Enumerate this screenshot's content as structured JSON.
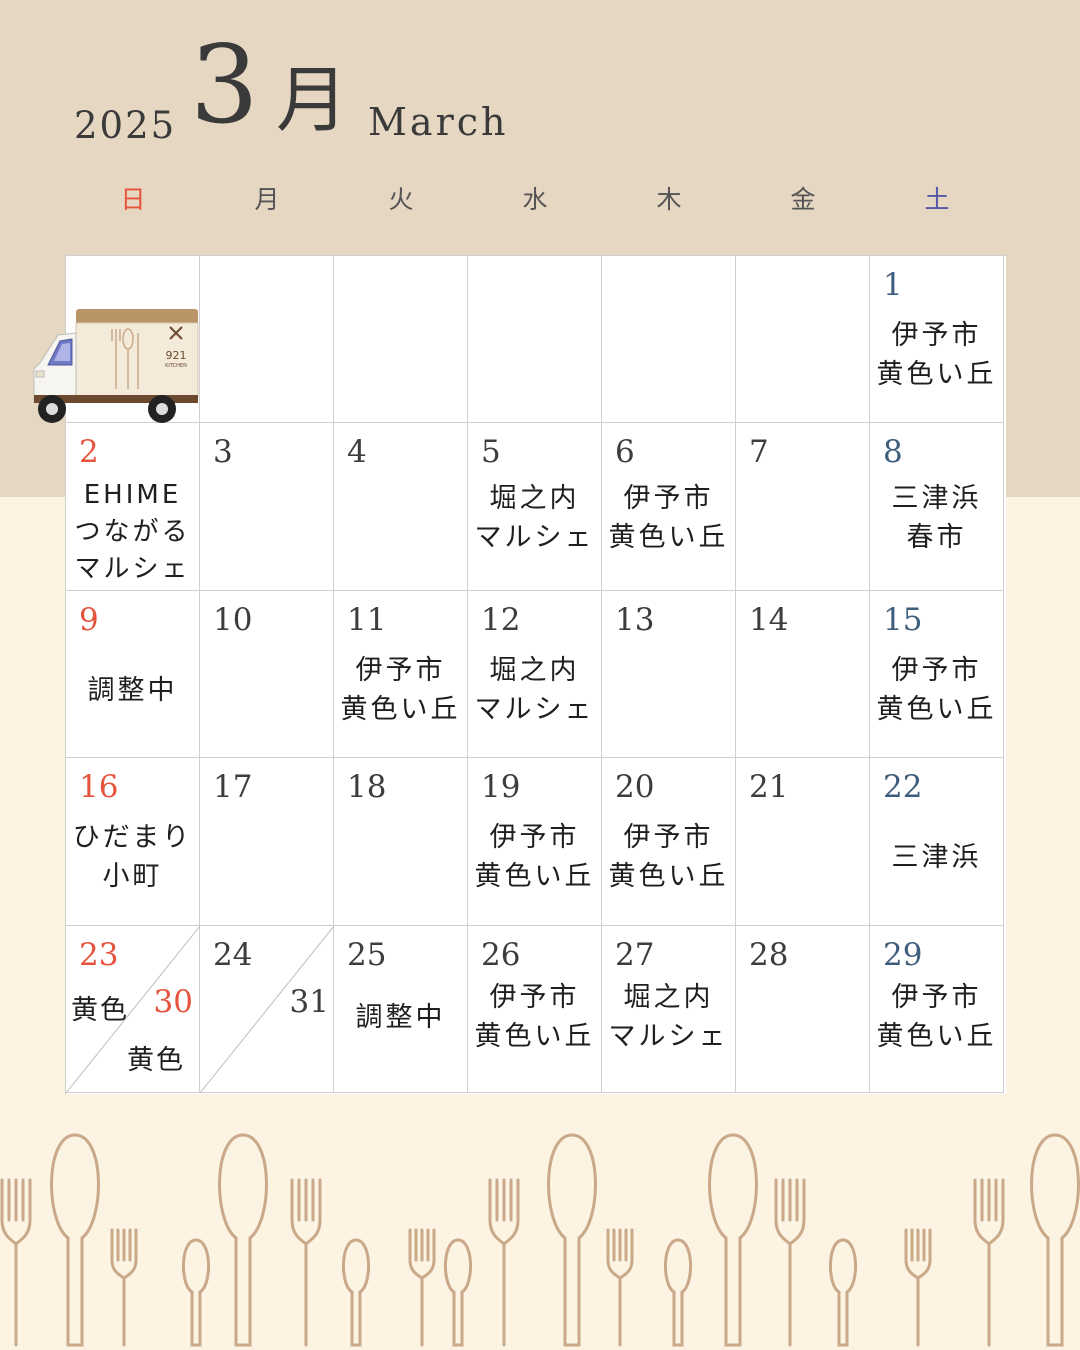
{
  "header": {
    "year": "2025",
    "month_number": "3",
    "month_kanji": "月",
    "month_english": "March"
  },
  "weekdays": [
    "日",
    "月",
    "火",
    "水",
    "木",
    "金",
    "土"
  ],
  "colors": {
    "sunday": "#e5533c",
    "saturday": "#5457a6",
    "top_band": "#e6d7c2",
    "background": "#fcf3e2",
    "cutlery_outline": "#c9a98a"
  },
  "icons": [
    "food-truck-icon",
    "cutlery-pattern"
  ],
  "truck_sign": {
    "number": "921",
    "text": "KITCHEN"
  },
  "calendar": {
    "d1": {
      "num": "1",
      "event": [
        "伊予市",
        "黄色い丘"
      ]
    },
    "d2": {
      "num": "2",
      "event": [
        "EHIME",
        "つながる",
        "マルシェ"
      ]
    },
    "d3": {
      "num": "3"
    },
    "d4": {
      "num": "4"
    },
    "d5": {
      "num": "5",
      "event": [
        "堀之内",
        "マルシェ"
      ]
    },
    "d6": {
      "num": "6",
      "event": [
        "伊予市",
        "黄色い丘"
      ]
    },
    "d7": {
      "num": "7"
    },
    "d8": {
      "num": "8",
      "event": [
        "三津浜",
        "春市"
      ]
    },
    "d9": {
      "num": "9",
      "event": [
        "調整中"
      ]
    },
    "d10": {
      "num": "10"
    },
    "d11": {
      "num": "11",
      "event": [
        "伊予市",
        "黄色い丘"
      ]
    },
    "d12": {
      "num": "12",
      "event": [
        "堀之内",
        "マルシェ"
      ]
    },
    "d13": {
      "num": "13"
    },
    "d14": {
      "num": "14"
    },
    "d15": {
      "num": "15",
      "event": [
        "伊予市",
        "黄色い丘"
      ]
    },
    "d16": {
      "num": "16",
      "event": [
        "ひだまり",
        "小町"
      ]
    },
    "d17": {
      "num": "17"
    },
    "d18": {
      "num": "18"
    },
    "d19": {
      "num": "19",
      "event": [
        "伊予市",
        "黄色い丘"
      ]
    },
    "d20": {
      "num": "20",
      "event": [
        "伊予市",
        "黄色い丘"
      ]
    },
    "d21": {
      "num": "21"
    },
    "d22": {
      "num": "22",
      "event": [
        "三津浜"
      ]
    },
    "d23": {
      "num": "23",
      "event": [
        "黄色"
      ]
    },
    "d30": {
      "num": "30",
      "event": [
        "黄色"
      ]
    },
    "d24": {
      "num": "24"
    },
    "d31": {
      "num": "31"
    },
    "d25": {
      "num": "25",
      "event": [
        "調整中"
      ]
    },
    "d26": {
      "num": "26",
      "event": [
        "伊予市",
        "黄色い丘"
      ]
    },
    "d27": {
      "num": "27",
      "event": [
        "堀之内",
        "マルシェ"
      ]
    },
    "d28": {
      "num": "28"
    },
    "d29": {
      "num": "29",
      "event": [
        "伊予市",
        "黄色い丘"
      ]
    }
  }
}
